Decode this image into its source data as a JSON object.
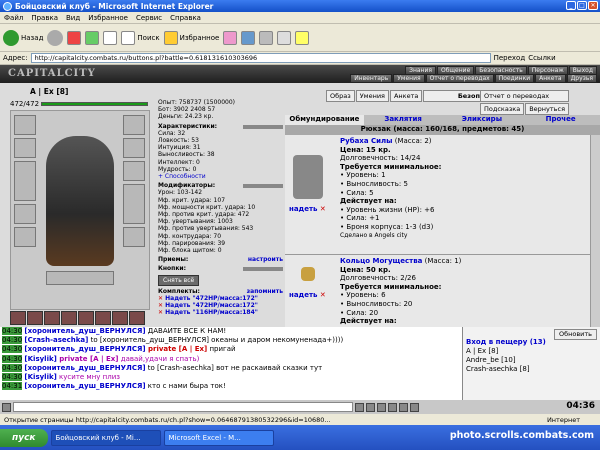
{
  "window": {
    "title": "Бойцовский клуб - Microsoft Internet Explorer"
  },
  "menu": [
    "Файл",
    "Правка",
    "Вид",
    "Избранное",
    "Сервис",
    "Справка"
  ],
  "toolbar": {
    "back": "Назад",
    "search": "Поиск",
    "favorites": "Избранное"
  },
  "address": {
    "label": "Адрес:",
    "url": "http://capitalcity.combats.ru/buttons.pl?battle=0.618131610303696",
    "go": "Переход",
    "links": "Ссылки"
  },
  "game": {
    "logo": "CAPITALCITY",
    "topnav": [
      "Знания",
      "Общение",
      "Безопасность",
      "Персонаж",
      "Выход"
    ],
    "subnav": [
      "Инвентарь",
      "Умения",
      "Отчет о переводах",
      "Поединки",
      "Анкета",
      "Друзья"
    ]
  },
  "char": {
    "name": "A | Ex [8]",
    "hp": "472/472",
    "exp_line": "Опыт: 758737 (1500000)",
    "bots_line": "Бот: 3902  2408  57",
    "money_line": "Деньги: 24.23 кр."
  },
  "stats": {
    "header": "Характеристики:",
    "lines": [
      "Сила: 32",
      "Ловкость: 53",
      "Интуиция: 31",
      "Выносливость: 38",
      "Интеллект: 0",
      "Мудрость: 0"
    ],
    "abilities": "+ Способности",
    "mods_header": "Модификаторы:",
    "mods": [
      "Урон: 103-142",
      "Мф. крит. удара: 107",
      "Мф. мощности крит. удара: 10",
      "Мф. против крит. удара: 472",
      "Мф. увертывания: 1003",
      "Мф. против увертывания: 543",
      "Мф. контрудара: 70",
      "Мф. парирования: 39",
      "Мф. блока щитом: 0"
    ],
    "techniques": "Приемы:",
    "configure": "настроить",
    "buttons_header": "Кнопки:",
    "remove_all": "Снять всё",
    "sets_header": "Комплекты:",
    "remember": "запомнить",
    "sets": [
      "Надеть \"472HP/масса:172\"",
      "Надеть \"472HP/масса:172\"",
      "Надеть \"116HP/масса:184\""
    ]
  },
  "topbuttons": [
    "Образ",
    "Умения",
    "Анкета",
    "Безопасность"
  ],
  "rightbuttons": [
    "Отчет о переводах",
    "Подсказка",
    "Вернуться"
  ],
  "tabs": [
    "Обмундирование",
    "Заклятия",
    "Эликсиры",
    "Прочее"
  ],
  "backpack": "Рюкзак (масса: 160/168, предметов: 45)",
  "items": [
    {
      "name": "Рубаха Силы",
      "mass": "(Масса: 2)",
      "price": "Цена: 15 кр.",
      "durability": "Долговечность: 14/24",
      "req_header": "Требуется минимальное:",
      "reqs": [
        "• Уровень: 1",
        "• Выносливость: 5",
        "• Сила: 5"
      ],
      "acts_header": "Действует на:",
      "acts": [
        "• Уровень жизни (HP): +6",
        "• Сила: +1",
        "• Броня корпуса: 1-3 (d3)"
      ],
      "made": "Сделано в Angels city",
      "wear": "надеть"
    },
    {
      "name": "Кольцо Могущества",
      "mass": "(Масса: 1)",
      "price": "Цена: 50 кр.",
      "durability": "Долговечность: 2/26",
      "req_header": "Требуется минимальное:",
      "reqs": [
        "• Уровень: 6",
        "• Выносливость: 20",
        "• Сила: 20"
      ],
      "acts_header": "Действует на:",
      "acts": [],
      "made": "",
      "wear": "надеть"
    }
  ],
  "chat": [
    {
      "t": "04:30",
      "u": "[хоронитель_душ_ВЕРНУЛСЯ]",
      "msg": " ДАВАЙТЕ ВСЕ К НАМ!"
    },
    {
      "t": "04:30",
      "u": "[Crash-asechka]",
      "msg": " to [хоронитель_душ_ВЕРНУЛСЯ] океаны и даром некомуненада+))))"
    },
    {
      "t": "04:30",
      "u": "[хоронитель_душ_ВЕРНУЛСЯ]",
      "pv": " private [A | Ex]",
      "msg": " пригай"
    },
    {
      "t": "04:30",
      "u": "[Kisylik]",
      "pv2": " private [A | Ex]",
      "msg": " давай,удачи я спать)"
    },
    {
      "t": "04:30",
      "u": "[хоронитель_душ_ВЕРНУЛСЯ]",
      "msg": " to [Crash-asechka] вот не раскаивай сказки тут"
    },
    {
      "t": "04:30",
      "u": "[Kisylik]",
      "msg2": " кусите мну плиз"
    },
    {
      "t": "04:31",
      "u": "[хоронитель_душ_ВЕРНУЛСЯ]",
      "msg": " кто с нами быра ток!"
    }
  ],
  "online": {
    "refresh": "Обновить",
    "header": "Вход в пещеру (13)",
    "users": [
      "A | Ex [8]",
      "Andre_be [10]",
      "Crash-asechka [8]"
    ]
  },
  "chatbar": {
    "clock": "04:36"
  },
  "statusbar": {
    "text": "Открытие страницы http://capitalcity.combats.ru/ch.pl?show=0.06468791380532296&id=10680...",
    "zone": "Интернет"
  },
  "taskbar": {
    "start": "пуск",
    "tasks": [
      "Бойцовский клуб - Mi...",
      "Microsoft Excel - M..."
    ],
    "watermark": "photo.scrolls.combats.com"
  }
}
